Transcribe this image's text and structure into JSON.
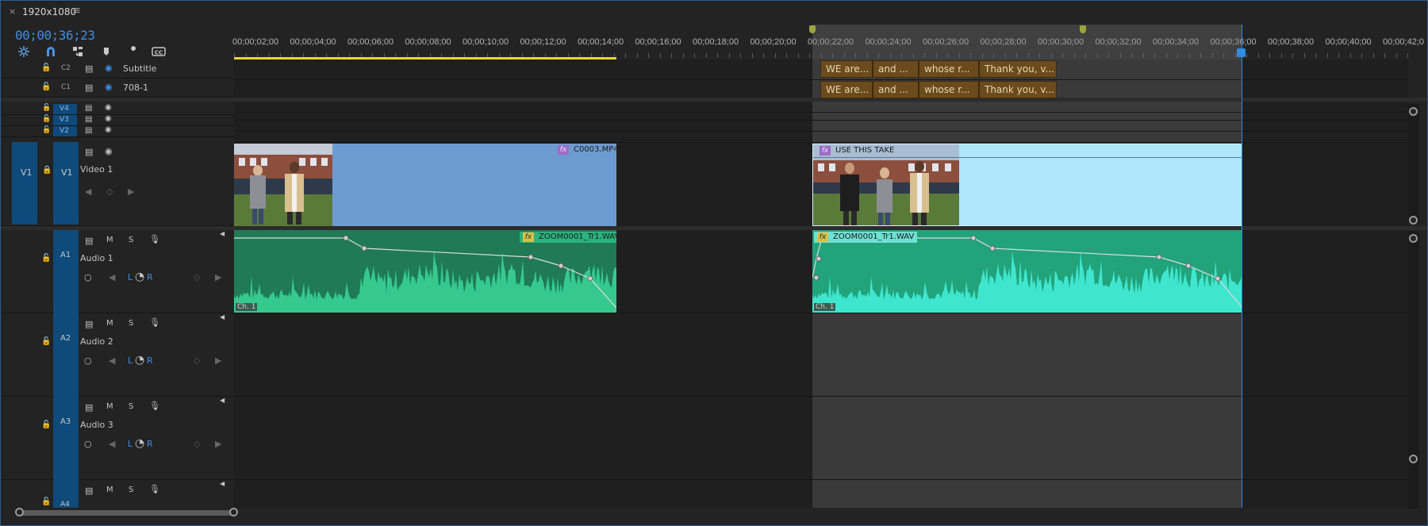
{
  "sequence": {
    "tab_title": "1920x1080",
    "close_glyph": "×",
    "menu_glyph": "≡",
    "timecode": "00;00;36;23"
  },
  "toolbar": {
    "snap_icon": "snap-icon",
    "magnet_icon": "magnet-icon",
    "link_icon": "linked-selection-icon",
    "marker_icon": "add-marker-icon",
    "wrench_icon": "wrench-icon",
    "cc_icon": "captions-icon"
  },
  "ruler": {
    "labels": [
      "00;00;02;00",
      "00;00;04;00",
      "00;00;06;00",
      "00;00;08;00",
      "00;00;10;00",
      "00;00;12;00",
      "00;00;14;00",
      "00;00;16;00",
      "00;00;18;00",
      "00;00;20;00",
      "00;00;22;00",
      "00;00;24;00",
      "00;00;26;00",
      "00;00;28;00",
      "00;00;30;00",
      "00;00;32;00",
      "00;00;34;00",
      "00;00;36;00",
      "00;00;38;00",
      "00;00;40;00",
      "00;00;42;0"
    ]
  },
  "tracks": {
    "c2": {
      "id": "C2",
      "name": "Subtitle"
    },
    "c1": {
      "id": "C1",
      "name": "708-1"
    },
    "v4": {
      "id": "V4"
    },
    "v3": {
      "id": "V3"
    },
    "v2": {
      "id": "V2"
    },
    "v1": {
      "id": "V1",
      "source": "V1",
      "name": "Video 1"
    },
    "a1": {
      "id": "A1",
      "name": "Audio 1"
    },
    "a2": {
      "id": "A2",
      "name": "Audio 2"
    },
    "a3": {
      "id": "A3",
      "name": "Audio 3"
    },
    "a4": {
      "id": "A4"
    },
    "mute": "M",
    "solo": "S",
    "pan_l": "L",
    "pan_r": "R"
  },
  "captions": {
    "row1": [
      "WE are...",
      "and ...",
      "whose r...",
      "Thank you, v..."
    ],
    "row2": [
      "WE are...",
      "and ...",
      "whose r...",
      "Thank you, v..."
    ]
  },
  "clips": {
    "video1": {
      "label": "C0003.MP4",
      "fx": "fx"
    },
    "video2": {
      "label": "USE THIS TAKE",
      "fx": "fx"
    },
    "audio1": {
      "label": "ZOOM0001_Tr1.WAV",
      "fx": "fx",
      "channel": "Ch. 1"
    },
    "audio2": {
      "label": "ZOOM0001_Tr1.WAV",
      "fx": "fx",
      "channel": "Ch. 1"
    }
  },
  "colors": {
    "accent": "#2f8de4",
    "caption": "#6b4b1c",
    "video_clip": "#6e9bcf",
    "video_clip_selected": "#aee6fb",
    "audio_clip": "#1f7a55",
    "audio_clip_selected": "#22a37a"
  }
}
